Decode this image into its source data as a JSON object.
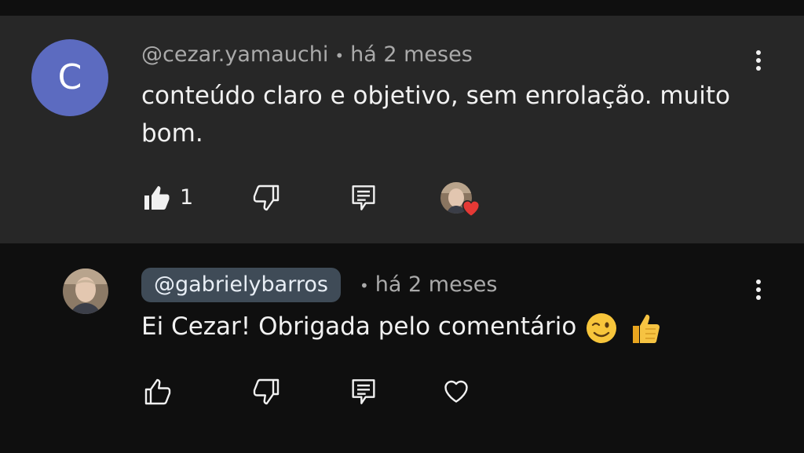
{
  "comment": {
    "avatar_letter": "C",
    "author": "@cezar.yamauchi",
    "separator": "•",
    "time": "há 2 meses",
    "text": "conteúdo claro e objetivo, sem enrolação. muito bom.",
    "like_count": "1",
    "colors": {
      "avatar_bg": "#5c6bc0",
      "background": "#272727",
      "heart": "#e53935"
    },
    "icons": [
      "kebab-menu-icon",
      "thumbs-up-filled-icon",
      "thumbs-down-icon",
      "reply-icon",
      "creator-heart-icon"
    ]
  },
  "reply": {
    "author": "@gabrielybarros",
    "separator": "•",
    "time": "há 2 meses",
    "text": "Ei Cezar! Obrigada pelo comentário",
    "emojis": [
      "winking-face",
      "thumbs-up"
    ],
    "colors": {
      "chip_bg": "#3f4b57",
      "background": "#0f0f0f"
    },
    "icons": [
      "kebab-menu-icon",
      "thumbs-up-outline-icon",
      "thumbs-down-icon",
      "reply-icon",
      "heart-outline-icon"
    ]
  }
}
